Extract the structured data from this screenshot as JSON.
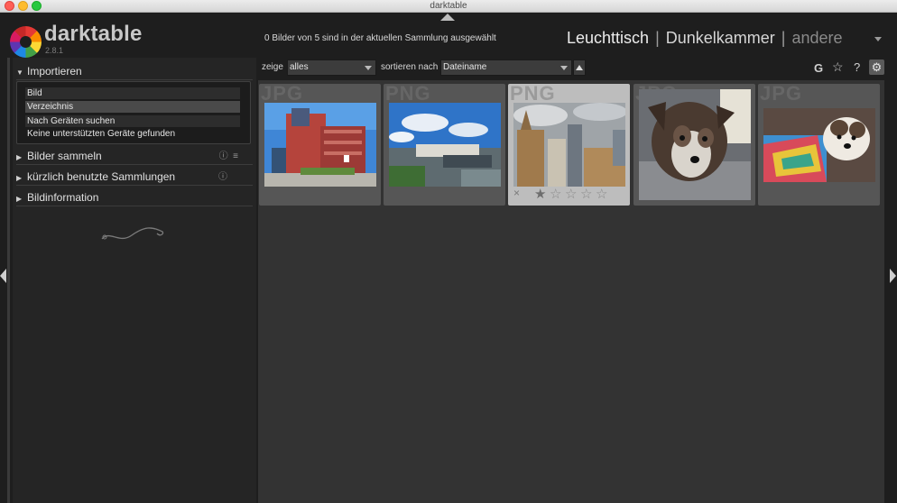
{
  "window": {
    "title": "darktable"
  },
  "app": {
    "name": "darktable",
    "version": "2.8.1"
  },
  "header": {
    "selection_info": "0 Bilder von 5 sind in der aktuellen Sammlung ausgewählt",
    "views": {
      "lighttable": "Leuchttisch",
      "darkroom": "Dunkelkammer",
      "other": "andere",
      "separator": "|"
    }
  },
  "left_panel": {
    "import": {
      "title": "Importieren",
      "items": [
        "Bild",
        "Verzeichnis",
        "Nach Geräten suchen"
      ],
      "selected_index": 1,
      "note": "Keine unterstützten Geräte gefunden"
    },
    "collect": {
      "title": "Bilder sammeln"
    },
    "recent": {
      "title": "kürzlich benutzte Sammlungen"
    },
    "info": {
      "title": "Bildinformation"
    },
    "section_icons": {
      "reset": "ⓘ",
      "presets": "≡"
    }
  },
  "toolbar": {
    "show_label": "zeige",
    "show_value": "alles",
    "sort_label": "sortieren nach",
    "sort_value": "Dateiname",
    "icons": {
      "grouping": "G",
      "overlays": "☆",
      "help": "?",
      "prefs": "⚙"
    }
  },
  "thumbnails": [
    {
      "ext": "JPG",
      "name": "container-building"
    },
    {
      "ext": "PNG",
      "name": "harbour-skyline"
    },
    {
      "ext": "PNG",
      "name": "cathedral-city"
    },
    {
      "ext": "JPG",
      "name": "dog-portrait"
    },
    {
      "ext": "JPG",
      "name": "dog-blanket"
    }
  ],
  "hover_thumb": {
    "reject": "×",
    "stars": [
      "★",
      "☆",
      "☆",
      "☆",
      "☆"
    ]
  }
}
